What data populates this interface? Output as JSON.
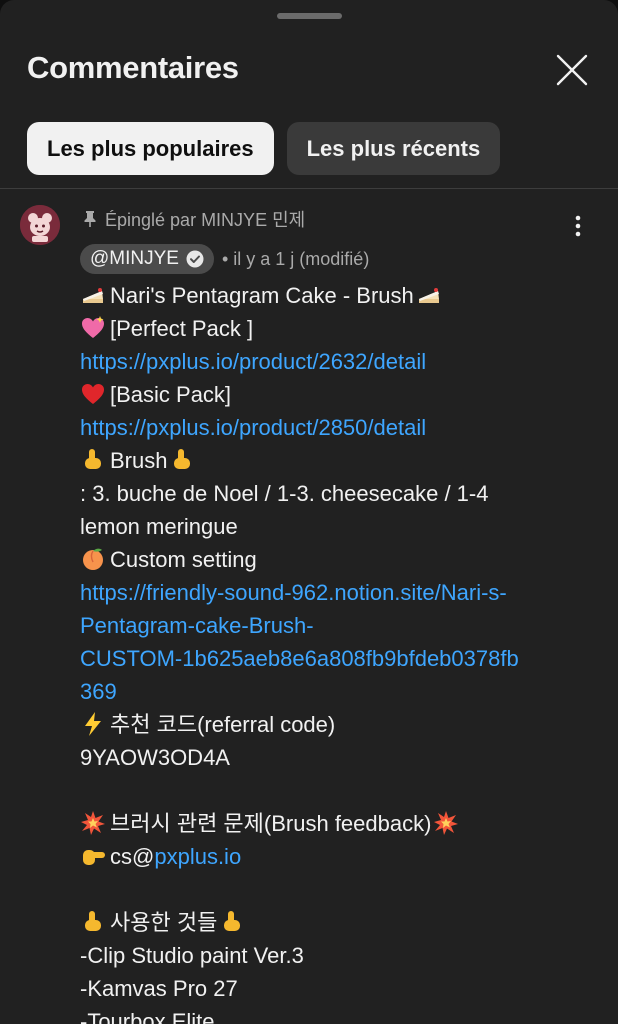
{
  "header": {
    "title": "Commentaires"
  },
  "tabs": [
    {
      "label": "Les plus populaires",
      "active": true
    },
    {
      "label": "Les plus récents",
      "active": false
    }
  ],
  "comment": {
    "pinned_text": "Épinglé par MINJYE 민제",
    "author_handle": "@MINJYE",
    "verified": true,
    "timestamp": "• il y a 1 j (modifié)",
    "lines": {
      "l1": "Nari's Pentagram Cake - Brush",
      "l2": "[Perfect Pack ]",
      "l3_link": "https://pxplus.io/product/2632/detail",
      "l4": "[Basic Pack]",
      "l5_link": "https://pxplus.io/product/2850/detail",
      "l6": "Brush",
      "l7": ": 3. buche de Noel / 1-3. cheesecake / 1-4",
      "l8": "lemon meringue",
      "l9": "Custom setting",
      "l10_link": "https://friendly-sound-962.notion.site/Nari-s-",
      "l11_link": "Pentagram-cake-Brush-",
      "l12_link": "CUSTOM-1b625aeb8e6a808fb9bfdeb0378fb",
      "l13_link": "369",
      "l14": "추천 코드(referral code)",
      "l15": "9YAOW3OD4A",
      "l17": "브러시 관련 문제(Brush feedback)",
      "l18_prefix": "cs@",
      "l18_link": "pxplus.io",
      "l20": "사용한 것들",
      "l21": "-Clip Studio paint Ver.3",
      "l22": "-Kamvas Pro 27",
      "l23": "-Tourbox Elite"
    }
  },
  "colors": {
    "background": "#212121",
    "link": "#3ea6ff",
    "secondary_text": "#aaaaaa",
    "chip_active": "#f1f1f1",
    "chip_inactive": "#3a3a3a"
  },
  "icons": {
    "close": "close-icon",
    "pin": "pin-icon",
    "more": "more-vertical-icon",
    "verified": "verified-check-icon"
  }
}
